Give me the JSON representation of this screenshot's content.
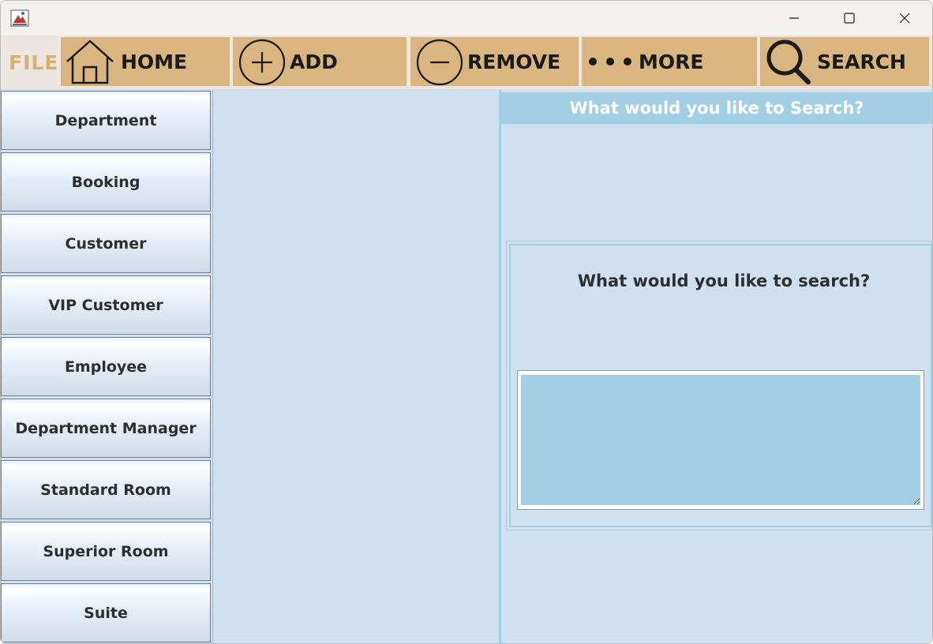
{
  "menu": {
    "file_label": "FILE"
  },
  "toolbar": {
    "home_label": "HOME",
    "add_label": "ADD",
    "remove_label": "REMOVE",
    "more_label": "MORE",
    "search_label": "SEARCH"
  },
  "sidebar": {
    "items": [
      {
        "label": "Department"
      },
      {
        "label": "Booking"
      },
      {
        "label": "Customer"
      },
      {
        "label": "VIP Customer"
      },
      {
        "label": "Employee"
      },
      {
        "label": "Department Manager"
      },
      {
        "label": "Standard Room"
      },
      {
        "label": "Superior Room"
      },
      {
        "label": "Suite"
      }
    ]
  },
  "search_panel": {
    "header": "What would you like to Search?",
    "prompt": "What would you like to search?",
    "input_value": ""
  },
  "colors": {
    "toolbar_button": "#d9b67f",
    "file_label": "#d9b06d",
    "panel_background": "#cfe1f1",
    "accent_blue": "#a2cfe3"
  },
  "icons": {
    "app": "java-app-icon",
    "home": "house-icon",
    "add": "plus-circle-icon",
    "remove": "minus-circle-icon",
    "more": "three-dots-icon",
    "search": "magnifier-icon"
  }
}
